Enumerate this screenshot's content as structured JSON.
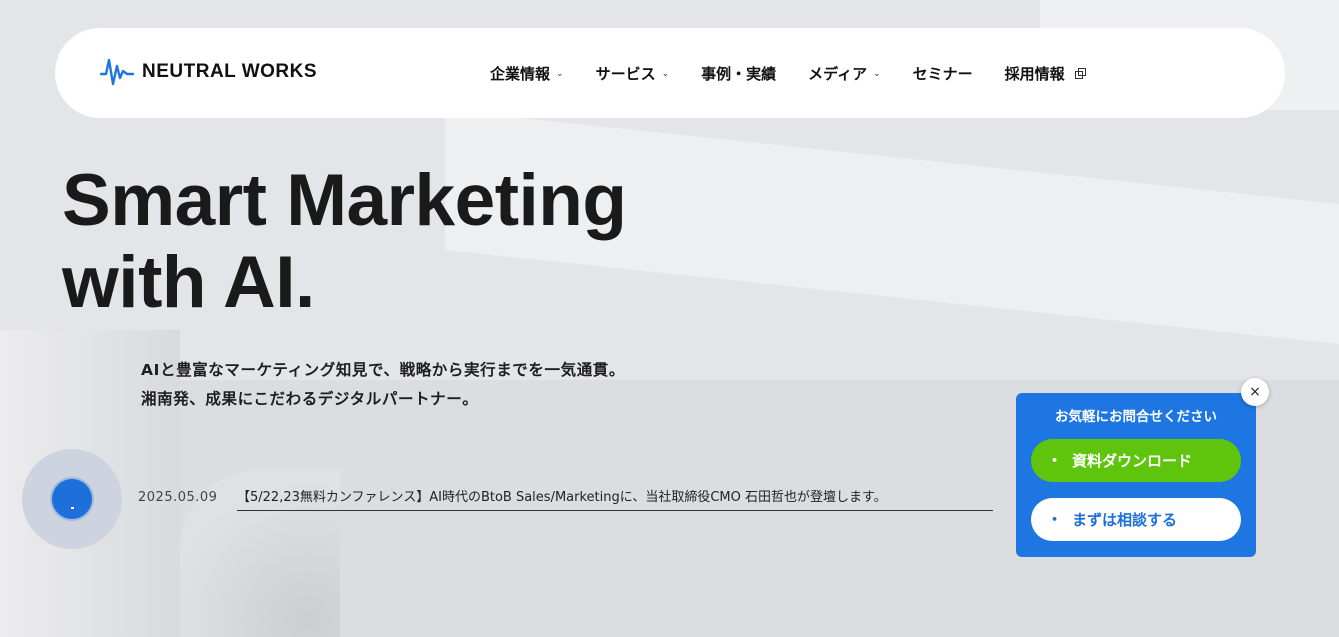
{
  "header": {
    "logo_text": "NEUTRAL WORKS",
    "nav": [
      {
        "label": "企業情報",
        "suffix": "chevron-down-icon"
      },
      {
        "label": "サービス",
        "suffix": "chevron-down-icon"
      },
      {
        "label": "事例・実績",
        "suffix": null
      },
      {
        "label": "メディア",
        "suffix": "chevron-down-icon"
      },
      {
        "label": "セミナー",
        "suffix": null
      },
      {
        "label": "採用情報",
        "suffix": "external-link-icon"
      }
    ]
  },
  "hero": {
    "title_line1": "Smart Marketing",
    "title_line2": "with AI.",
    "subtitle_line1": "AIと豊富なマーケティング知見で、戦略から実行までを一気通貫。",
    "subtitle_line2": "湘南発、成果にこだわるデジタルパートナー。"
  },
  "news": {
    "date": "2025.05.09",
    "text": "【5/22,23無料カンファレンス】AI時代のBtoB Sales/Marketingに、当社取締役CMO 石田哲也が登壇します。"
  },
  "contact": {
    "title": "お気軽にお問合せください",
    "download_label": "資料ダウンロード",
    "consult_label": "まずは相談する",
    "close_glyph": "×"
  },
  "colors": {
    "brand_blue": "#1e76e3",
    "green": "#5fc40c",
    "text_dark": "#1a1a1a"
  }
}
